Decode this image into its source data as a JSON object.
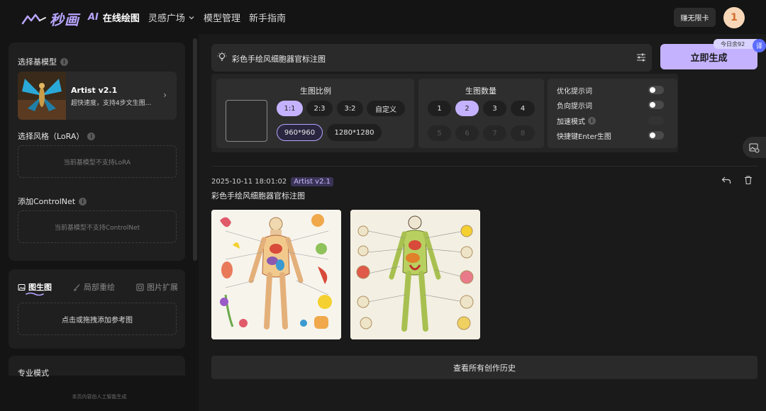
{
  "brand": {
    "logo_text": "秒画"
  },
  "nav": {
    "ai_prefix": "AI",
    "items": [
      {
        "label": "在线绘图"
      },
      {
        "label": "灵感广场"
      },
      {
        "label": "模型管理"
      },
      {
        "label": "新手指南"
      }
    ]
  },
  "header": {
    "unlimited_label": "赚无限卡",
    "avatar_initial": "1"
  },
  "sidebar": {
    "base_model_label": "选择基模型",
    "model": {
      "name": "Artist v2.1",
      "desc": "超快速度，支持4步文生图..."
    },
    "lora_label": "选择风格（LoRA）",
    "lora_empty": "当前基模型不支持LoRA",
    "controlnet_label": "添加ControlNet",
    "controlnet_empty": "当前基模型不支持ControlNet",
    "tabs": [
      {
        "label": "图生图",
        "icon": "image-icon"
      },
      {
        "label": "局部重绘",
        "icon": "brush-icon"
      },
      {
        "label": "图片扩展",
        "icon": "expand-icon"
      }
    ],
    "upload_text": "点击或拖拽添加参考图",
    "pro_mode_label": "专业模式",
    "footer_note": "本页内容由人工智能生成"
  },
  "prompt": {
    "value": "彩色手绘风细胞器官标注图",
    "generate_label": "立即生成",
    "quota_text": "今日余92"
  },
  "settings": {
    "ratio_title": "生图比例",
    "ratios": [
      "1:1",
      "2:3",
      "3:2",
      "自定义"
    ],
    "selected_ratio": "1:1",
    "sizes": [
      "960*960",
      "1280*1280"
    ],
    "selected_size": "960*960",
    "count_title": "生图数量",
    "counts": [
      "1",
      "2",
      "3",
      "4",
      "5",
      "6",
      "7",
      "8"
    ],
    "selected_count": "2",
    "options": [
      {
        "label": "优化提示词",
        "enabled": true
      },
      {
        "label": "负向提示词",
        "enabled": true
      },
      {
        "label": "加速模式",
        "enabled": false
      },
      {
        "label": "快捷键Enter生图",
        "enabled": true
      }
    ]
  },
  "record": {
    "timestamp": "2025-10-11 18:01:02",
    "model_tag": "Artist v2.1",
    "title": "彩色手绘风细胞器官标注图"
  },
  "history_label": "查看所有创作历史",
  "colors": {
    "accent": "#c4b2ff",
    "background": "#141414",
    "panel": "#1f1f1f"
  }
}
